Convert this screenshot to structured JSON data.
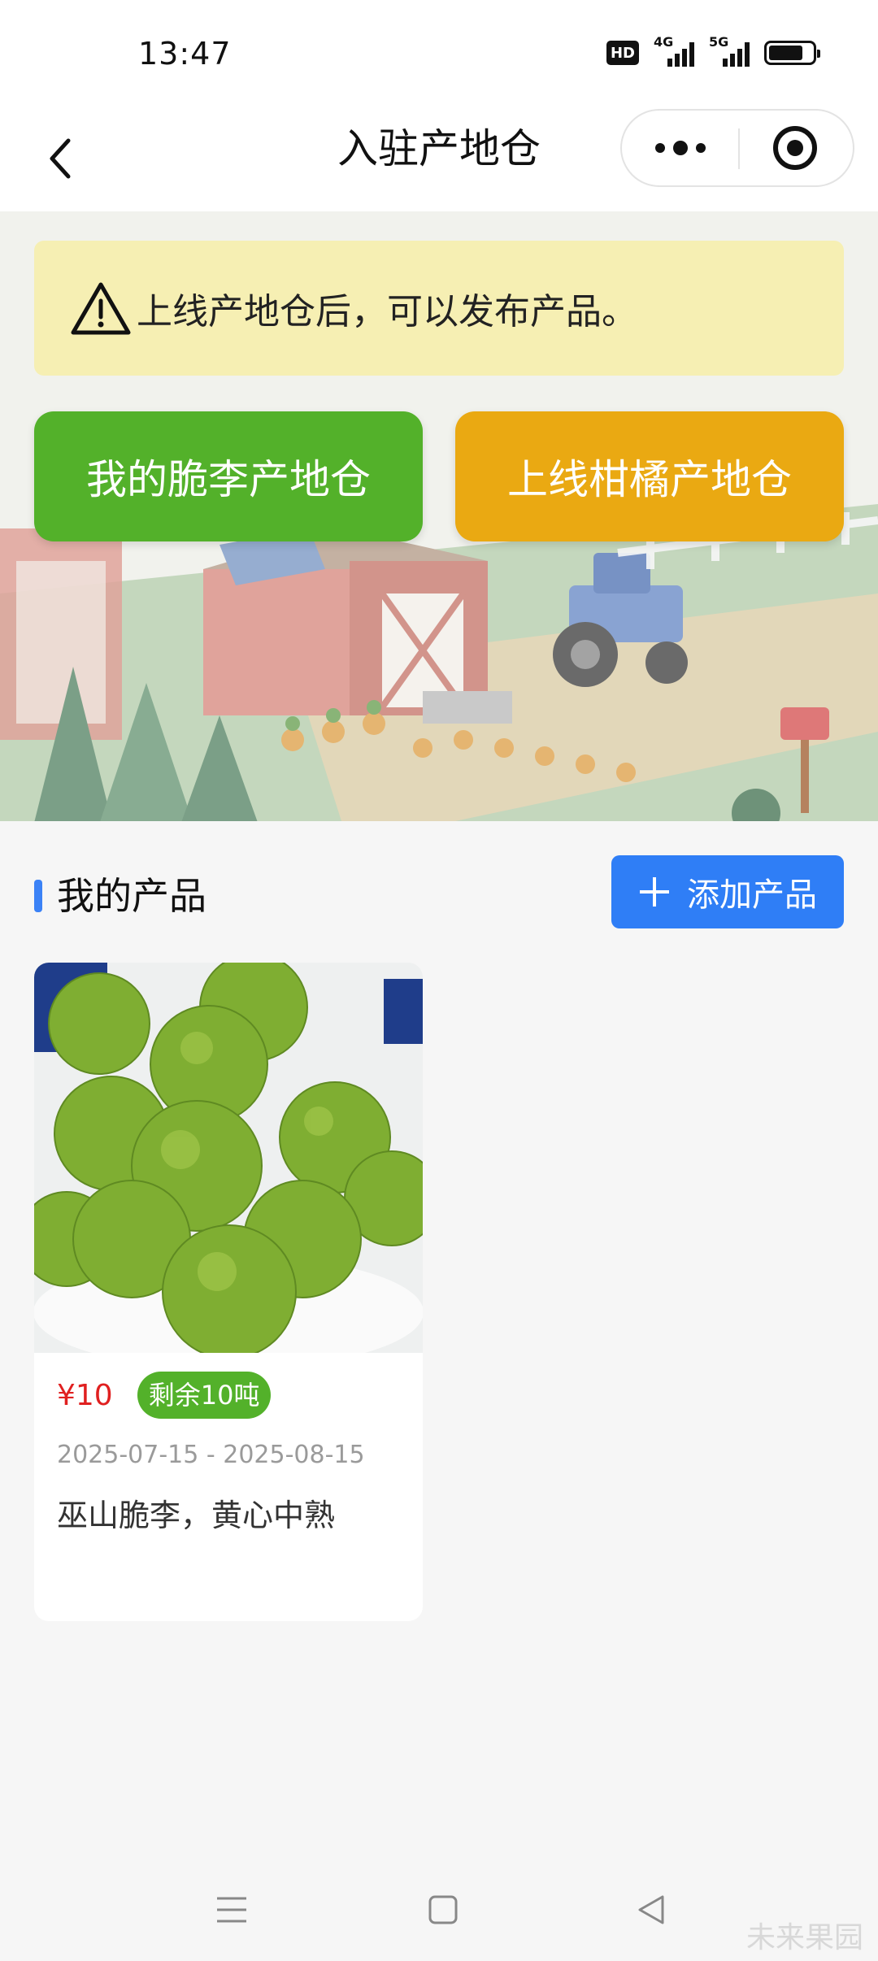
{
  "status_bar": {
    "time": "13:47",
    "hd_label": "HD",
    "network_1": "4G",
    "network_2": "5G",
    "battery_level": 0.7
  },
  "nav": {
    "title": "入驻产地仓",
    "back_icon": "chevron-left-icon",
    "more_icon": "more-dots-icon",
    "close_icon": "target-circle-icon"
  },
  "hero": {
    "notice": "上线产地仓后，可以发布产品。",
    "notice_icon": "warning-triangle-icon",
    "primary_button": "我的脆李产地仓",
    "secondary_button": "上线柑橘产地仓",
    "colors": {
      "green": "#53b12a",
      "orange": "#eaa912",
      "notice_bg": "#f6efb3"
    }
  },
  "products_section": {
    "title": "我的产品",
    "add_button": "添加产品",
    "accent": "#3b82f6"
  },
  "products": [
    {
      "price": "¥10",
      "stock": "剩余10吨",
      "date_range": "2025-07-15 - 2025-08-15",
      "description": "巫山脆李，黄心中熟"
    }
  ],
  "system_nav": {
    "menu_icon": "menu-icon",
    "home_icon": "square-home-icon",
    "back_icon": "triangle-back-icon"
  },
  "watermark": "未来果园"
}
